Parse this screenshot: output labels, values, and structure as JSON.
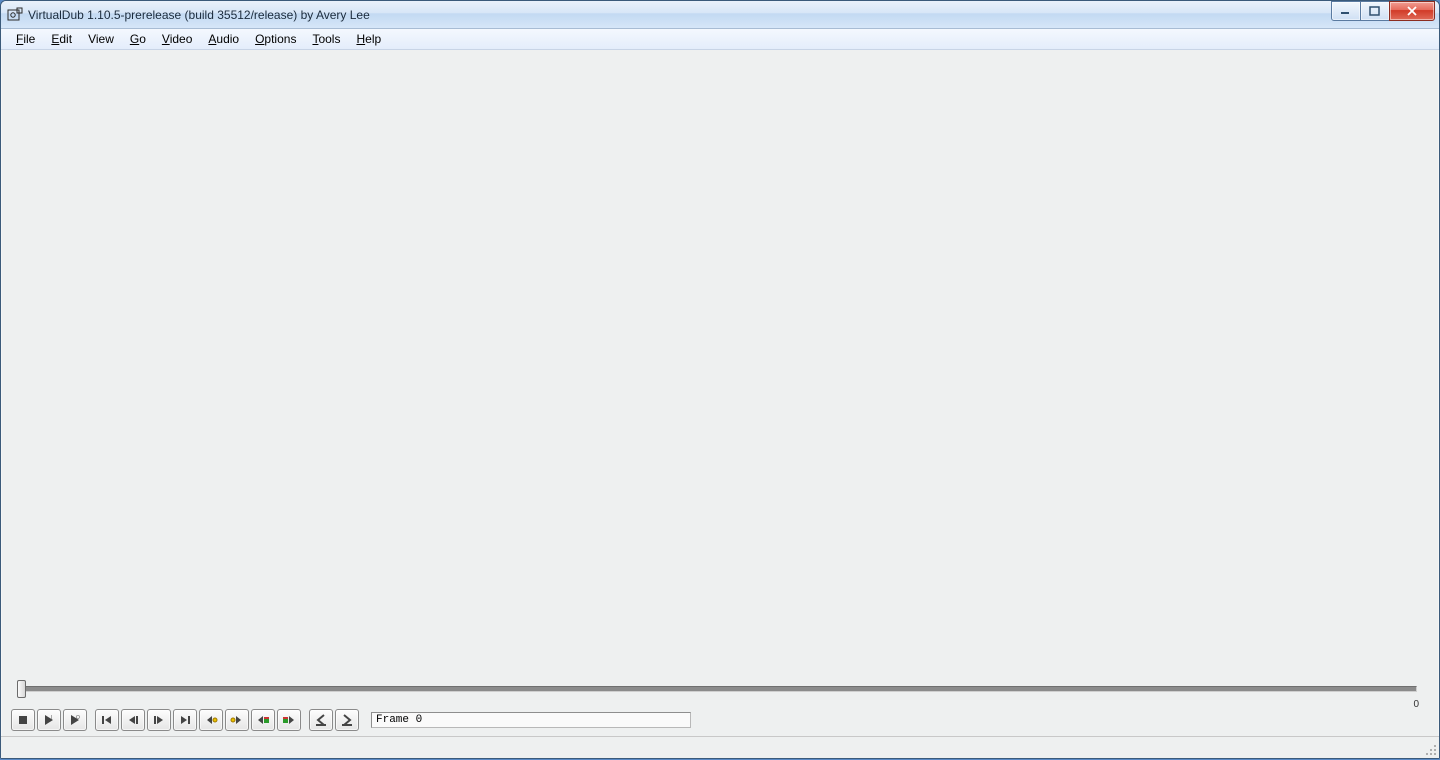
{
  "window": {
    "title": "VirtualDub 1.10.5-prerelease (build 35512/release) by Avery Lee"
  },
  "menu": {
    "items": [
      {
        "label": "File",
        "accel": "F"
      },
      {
        "label": "Edit",
        "accel": "E"
      },
      {
        "label": "View",
        "accel": ""
      },
      {
        "label": "Go",
        "accel": "G"
      },
      {
        "label": "Video",
        "accel": "V"
      },
      {
        "label": "Audio",
        "accel": "A"
      },
      {
        "label": "Options",
        "accel": "O"
      },
      {
        "label": "Tools",
        "accel": "T"
      },
      {
        "label": "Help",
        "accel": "H"
      }
    ]
  },
  "timeline": {
    "position": 0,
    "end_label": "0"
  },
  "toolbar": {
    "buttons": {
      "stop": "stop-icon",
      "play_input": "play-input-icon",
      "play_output": "play-output-icon",
      "go_start": "go-start-icon",
      "step_back": "step-back-icon",
      "step_forward": "step-forward-icon",
      "go_end": "go-end-icon",
      "key_prev": "key-prev-icon",
      "key_next": "key-next-icon",
      "scene_prev": "scene-prev-icon",
      "scene_next": "scene-next-icon",
      "mark_in": "mark-in-icon",
      "mark_out": "mark-out-icon"
    }
  },
  "status": {
    "frame_text": "Frame 0"
  },
  "colors": {
    "titlebar_grad_top": "#eaf2fb",
    "titlebar_grad_bottom": "#d6e6f8",
    "close_red": "#d13a27",
    "track_fill": "#8b8b8b"
  }
}
